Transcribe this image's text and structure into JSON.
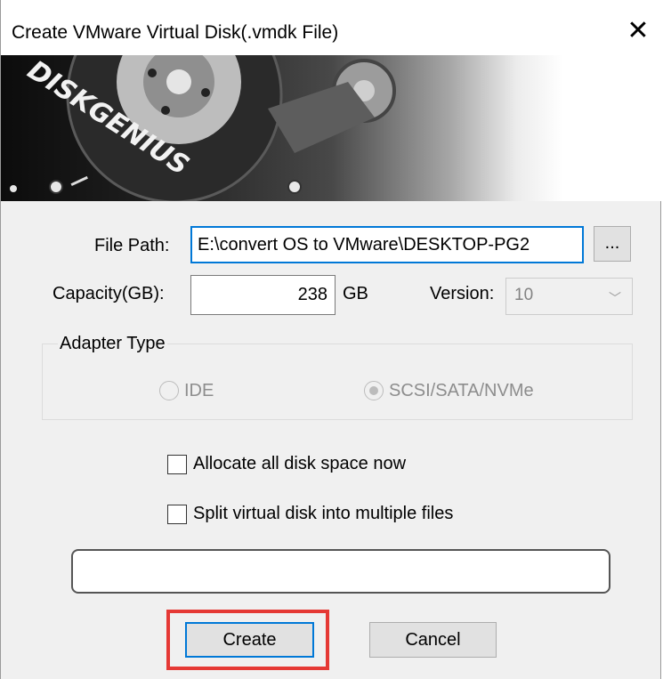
{
  "window": {
    "title": "Create VMware Virtual Disk(.vmdk File)",
    "close_symbol": "✕"
  },
  "banner": {
    "logo_text": "DISKGENIUS"
  },
  "form": {
    "file_path_label": "File Path:",
    "file_path_value": "E:\\convert OS to VMware\\DESKTOP-PG2",
    "browse_label": "...",
    "capacity_label": "Capacity(GB):",
    "capacity_value": "238",
    "capacity_unit": "GB",
    "version_label": "Version:",
    "version_value": "10"
  },
  "adapter": {
    "group_label": "Adapter Type",
    "options": [
      {
        "label": "IDE",
        "selected": false
      },
      {
        "label": "SCSI/SATA/NVMe",
        "selected": true
      }
    ]
  },
  "options": {
    "allocate_label": "Allocate all disk space now",
    "allocate_checked": false,
    "split_label": "Split virtual disk into multiple files",
    "split_checked": false
  },
  "progress": {
    "fraction": 0
  },
  "buttons": {
    "create_label": "Create",
    "cancel_label": "Cancel"
  },
  "colors": {
    "focus_border": "#0078d7",
    "highlight_box": "#e53935"
  },
  "icons": {
    "close": "close-icon",
    "combo_arrow": "chevron-down-icon"
  }
}
